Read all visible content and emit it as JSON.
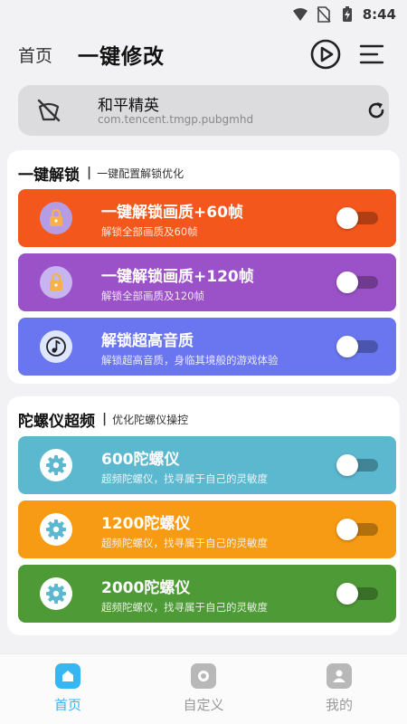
{
  "status_bar": {
    "time": "8:44"
  },
  "header": {
    "home_label": "首页",
    "title": "一键修改"
  },
  "app": {
    "name": "和平精英",
    "package": "com.tencent.tmgp.pubgmhd"
  },
  "sections": [
    {
      "title": "一键解锁",
      "subtitle": "一键配置解锁优化",
      "items": [
        {
          "title": "一键解锁画质+60帧",
          "desc": "解锁全部画质及60帧",
          "color": "#f4571c",
          "icon": "lock-icon",
          "enabled": false
        },
        {
          "title": "一键解锁画质+120帧",
          "desc": "解锁全部画质及120帧",
          "color": "#9b51c7",
          "icon": "lock-icon",
          "enabled": false
        },
        {
          "title": "解锁超高音质",
          "desc": "解锁超高音质，身临其境般的游戏体验",
          "color": "#6a76f0",
          "icon": "music-note-icon",
          "enabled": false
        }
      ]
    },
    {
      "title": "陀螺仪超频",
      "subtitle": "优化陀螺仪操控",
      "items": [
        {
          "title": "600陀螺仪",
          "desc": "超频陀螺仪，找寻属于自己的灵敏度",
          "color": "#5bb8cf",
          "icon": "gear-icon",
          "enabled": false
        },
        {
          "title": "1200陀螺仪",
          "desc": "超频陀螺仪，找寻属于自己的灵敏度",
          "color": "#f79a14",
          "icon": "gear-icon",
          "enabled": false
        },
        {
          "title": "2000陀螺仪",
          "desc": "超频陀螺仪，找寻属于自己的灵敏度",
          "color": "#4e9a36",
          "icon": "gear-icon",
          "enabled": false
        }
      ]
    }
  ],
  "bottom_nav": [
    {
      "label": "首页",
      "icon": "home-icon",
      "active": true
    },
    {
      "label": "自定义",
      "icon": "custom-icon",
      "active": false
    },
    {
      "label": "我的",
      "icon": "profile-icon",
      "active": false
    }
  ],
  "colors": {
    "accent": "#37b6f2",
    "inactive": "#999999"
  }
}
